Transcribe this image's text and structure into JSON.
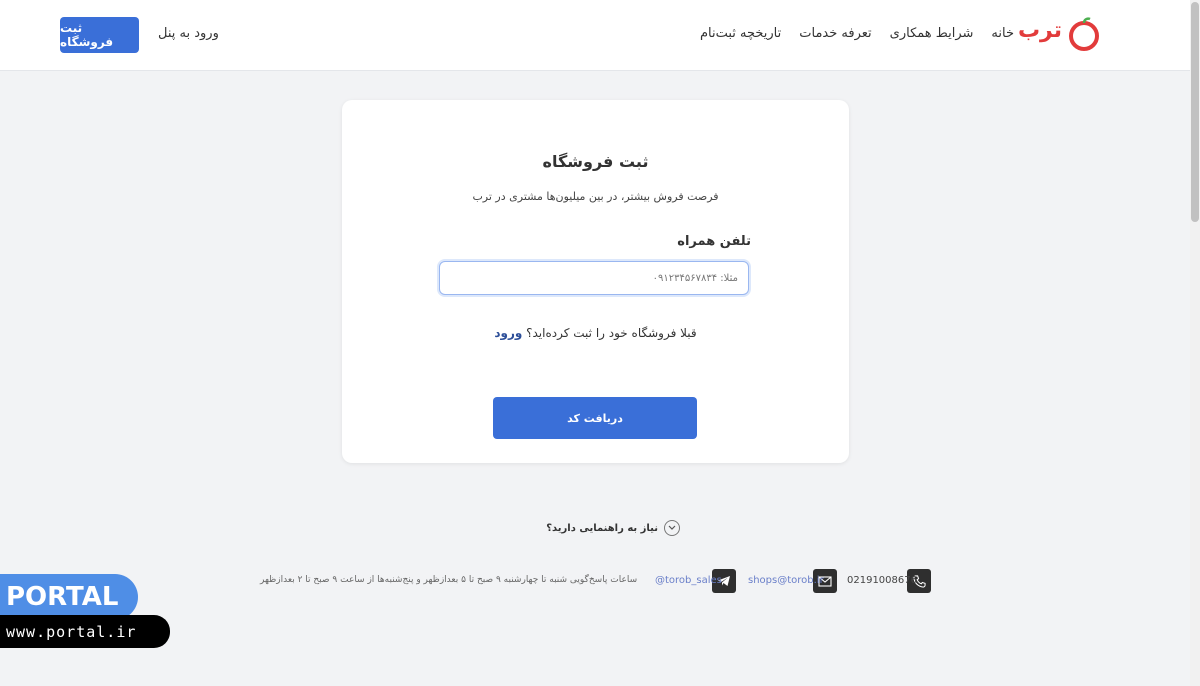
{
  "header": {
    "logo_text": "ترب",
    "nav": [
      "خانه",
      "شرایط همکاری",
      "تعرفه خدمات",
      "تاریخچه ثبت‌نام"
    ],
    "login_label": "ورود به پنل",
    "register_label": "ثبت فروشگاه"
  },
  "card": {
    "title": "ثبت فروشگاه",
    "subtitle": "فرصت فروش بیشتر، در بین میلیون‌ها مشتری در ترب",
    "phone_label": "تلفن همراه",
    "phone_placeholder": "مثلا: ۰۹۱۲۳۴۵۶۷۸۳۴",
    "phone_value": "",
    "already_registered": "قبلا فروشگاه خود را ثبت کرده‌اید؟",
    "login_link": "ورود",
    "submit_label": "دریافت کد"
  },
  "help": {
    "label": "نیاز به راهنمایی دارید؟",
    "icon": "chevron-down-icon"
  },
  "footer": {
    "phone": "02191008676",
    "email": "shops@torob.ir",
    "telegram": "@torob_sales",
    "hours": "ساعات پاسخ‌گویی شنبه تا چهارشنبه ۹ صبح تا ۵ بعدازظهر و پنج‌شنبه‌ها از ساعت ۹ صبح تا ۲ بعدازظهر"
  },
  "watermark": {
    "brand": "PORTAL",
    "url": "www.portal.ir"
  },
  "colors": {
    "primary": "#3a6fd8",
    "logo_red": "#e23b3b",
    "background": "#f2f3f5",
    "link": "#2d4f99"
  }
}
